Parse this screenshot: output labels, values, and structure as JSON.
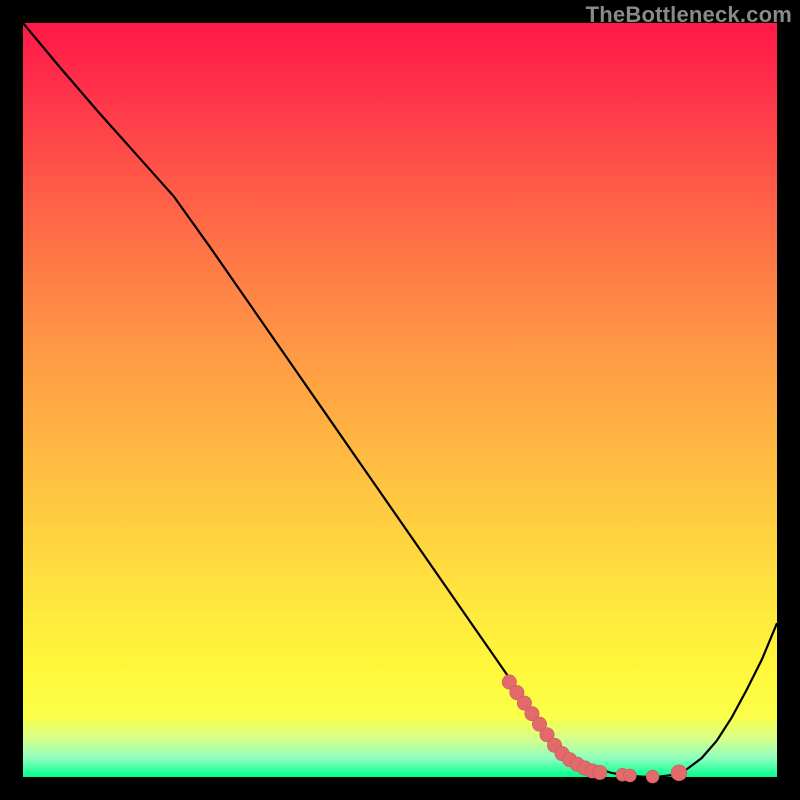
{
  "watermark": "TheBottleneck.com",
  "colors": {
    "page_bg": "#000000",
    "curve": "#000000",
    "marker_fill": "#e26a6a",
    "marker_stroke": "#c85a5a"
  },
  "chart_data": {
    "type": "line",
    "title": "",
    "xlabel": "",
    "ylabel": "",
    "xlim": [
      0,
      100
    ],
    "ylim": [
      0,
      100
    ],
    "grid": false,
    "legend": false,
    "annotations": [],
    "series": [
      {
        "name": "curve",
        "x": [
          0,
          5,
          10,
          15,
          20,
          25,
          30,
          35,
          40,
          45,
          50,
          55,
          60,
          62,
          64,
          66,
          68,
          70,
          72,
          74,
          76,
          78,
          80,
          82,
          84,
          86,
          88,
          90,
          92,
          94,
          96,
          98,
          100
        ],
        "y": [
          100,
          94.0,
          88.2,
          82.6,
          77.0,
          70.0,
          62.8,
          55.6,
          48.4,
          41.2,
          34.0,
          26.8,
          19.6,
          16.72,
          13.84,
          10.96,
          8.08,
          5.2,
          3.4,
          2.1,
          1.2,
          0.55,
          0.2,
          0.05,
          0.0,
          0.25,
          1.0,
          2.5,
          4.8,
          7.9,
          11.6,
          15.6,
          20.4
        ]
      }
    ],
    "markers": [
      {
        "x": 64.5,
        "y": 12.6,
        "r": 0.95
      },
      {
        "x": 65.5,
        "y": 11.2,
        "r": 0.95
      },
      {
        "x": 66.5,
        "y": 9.8,
        "r": 0.95
      },
      {
        "x": 67.5,
        "y": 8.4,
        "r": 0.95
      },
      {
        "x": 68.5,
        "y": 7.0,
        "r": 0.95
      },
      {
        "x": 69.5,
        "y": 5.6,
        "r": 0.95
      },
      {
        "x": 70.5,
        "y": 4.2,
        "r": 0.95
      },
      {
        "x": 71.5,
        "y": 3.1,
        "r": 0.95
      },
      {
        "x": 72.5,
        "y": 2.3,
        "r": 0.95
      },
      {
        "x": 73.5,
        "y": 1.7,
        "r": 0.95
      },
      {
        "x": 74.5,
        "y": 1.2,
        "r": 0.95
      },
      {
        "x": 75.5,
        "y": 0.8,
        "r": 0.95
      },
      {
        "x": 76.5,
        "y": 0.6,
        "r": 0.95
      },
      {
        "x": 79.5,
        "y": 0.3,
        "r": 0.85
      },
      {
        "x": 80.5,
        "y": 0.2,
        "r": 0.85
      },
      {
        "x": 83.5,
        "y": 0.05,
        "r": 0.85
      },
      {
        "x": 87.0,
        "y": 0.55,
        "r": 1.05
      }
    ]
  }
}
